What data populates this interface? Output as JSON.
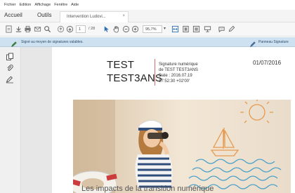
{
  "menu": [
    "Fichier",
    "Edition",
    "Affichage",
    "Fenêtre",
    "Aide"
  ],
  "tabs": {
    "home": "Accueil",
    "tools": "Outils",
    "document": "Intervention Ludovi...",
    "close_glyph": "×"
  },
  "toolbar": {
    "page_current": "1",
    "page_total": "/ 28",
    "zoom": "95,7%"
  },
  "signature_bar": {
    "message": "Signé au moyen de signatures valables.",
    "panel_button": "Panneau Signature"
  },
  "document": {
    "signer_line1": "TEST",
    "signer_line2": "TEST3ANS",
    "sig_lines": [
      "Signature numérique",
      "de TEST TEST3ANS",
      "Date : 2016.07.19",
      "17:52:30 +02'00'"
    ],
    "date": "01/07/2016",
    "caption": "Les impacts de la transition numérique"
  },
  "colors": {
    "signature_banner": "#cde1f1",
    "signature_divider": "#e06a6a",
    "accent": "#2c6fb3"
  }
}
